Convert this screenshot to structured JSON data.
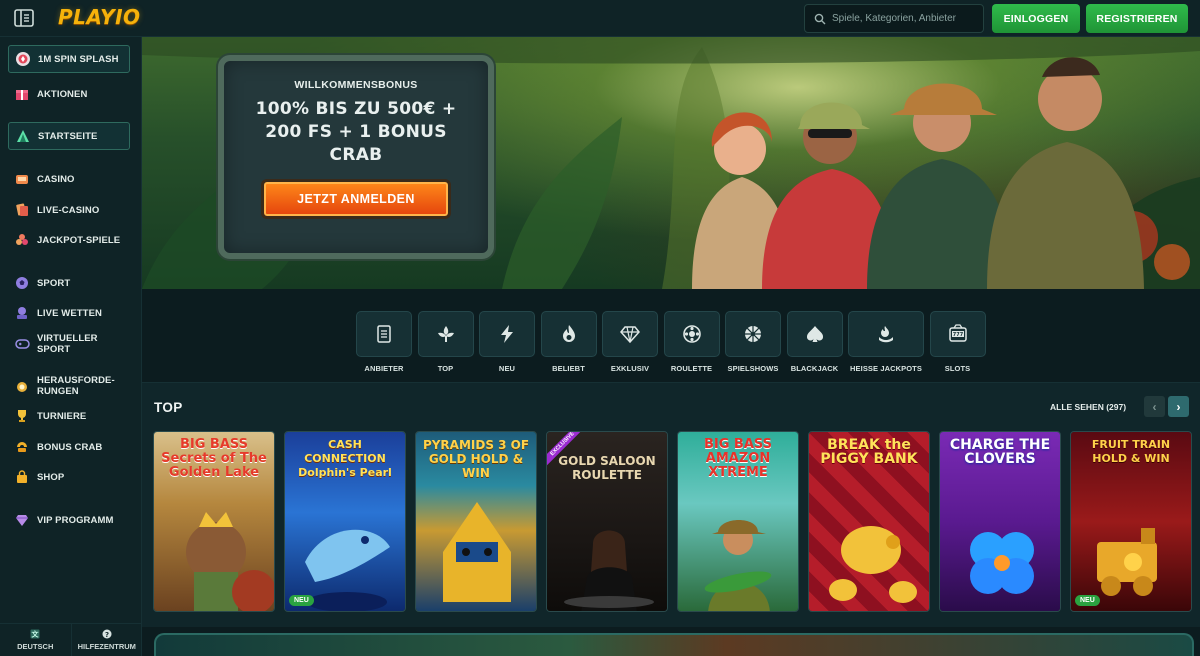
{
  "header": {
    "logo": "PLAYIO",
    "search_placeholder": "Spiele, Kategorien, Anbieter",
    "login_label": "EINLOGGEN",
    "register_label": "REGISTRIEREN"
  },
  "sidebar": {
    "items": [
      {
        "label": "1M SPIN SPLASH",
        "icon": "splash-icon"
      },
      {
        "label": "AKTIONEN",
        "icon": "gift-icon"
      },
      {
        "label": "STARTSEITE",
        "icon": "home-icon"
      },
      {
        "label": "CASINO",
        "icon": "casino-icon"
      },
      {
        "label": "LIVE-CASINO",
        "icon": "live-casino-icon"
      },
      {
        "label": "JACKPOT-SPIELE",
        "icon": "jackpot-icon"
      },
      {
        "label": "SPORT",
        "icon": "soccer-ball-icon"
      },
      {
        "label": "LIVE WETTEN",
        "icon": "live-bet-icon"
      },
      {
        "label": "VIRTUELLER SPORT",
        "icon": "gamepad-icon"
      },
      {
        "label": "HERAUSFORDE-RUNGEN",
        "icon": "medal-icon"
      },
      {
        "label": "TURNIERE",
        "icon": "trophy-icon"
      },
      {
        "label": "BONUS CRAB",
        "icon": "claw-icon"
      },
      {
        "label": "SHOP",
        "icon": "shopping-bag-icon"
      },
      {
        "label": "VIP PROGRAMM",
        "icon": "diamond-icon"
      }
    ],
    "footer": {
      "language": "DEUTSCH",
      "help": "HILFEZENTRUM"
    }
  },
  "hero": {
    "kicker": "WILLKOMMENSBONUS",
    "title": "100% BIS ZU 500€ + 200 FS + 1 BONUS CRAB",
    "cta": "JETZT ANMELDEN"
  },
  "categories": [
    {
      "label": "ANBIETER",
      "icon": "provider-icon"
    },
    {
      "label": "TOP",
      "icon": "fleur-icon"
    },
    {
      "label": "NEU",
      "icon": "lightning-icon"
    },
    {
      "label": "BELIEBT",
      "icon": "flame-icon"
    },
    {
      "label": "EXKLUSIV",
      "icon": "gem-icon"
    },
    {
      "label": "ROULETTE",
      "icon": "roulette-icon"
    },
    {
      "label": "SPIELSHOWS",
      "icon": "wheel-icon"
    },
    {
      "label": "BLACKJACK",
      "icon": "spade-icon"
    },
    {
      "label": "HEISSE JACKPOTS",
      "icon": "hot-jackpot-icon"
    },
    {
      "label": "SLOTS",
      "icon": "slot-machine-icon"
    }
  ],
  "top_section": {
    "title": "TOP",
    "see_all": "ALLE SEHEN (297)",
    "games": [
      {
        "title": "BIG BASS Secrets of The Golden Lake",
        "badge": ""
      },
      {
        "title": "CASH CONNECTION Dolphin's Pearl",
        "badge": "NEU"
      },
      {
        "title": "PYRAMIDS 3 OF GOLD HOLD & WIN",
        "badge": ""
      },
      {
        "title": "GOLD SALOON ROULETTE",
        "badge": "EXCLUSIVE"
      },
      {
        "title": "BIG BASS AMAZON XTREME",
        "badge": ""
      },
      {
        "title": "BREAK the PIGGY BANK",
        "badge": ""
      },
      {
        "title": "CHARGE THE CLOVERS",
        "badge": ""
      },
      {
        "title": "FRUIT TRAIN HOLD & WIN",
        "badge": "NEU"
      }
    ]
  },
  "colors": {
    "accent_green": "#2fbb4b",
    "cta_orange": "#ff8a1a",
    "background": "#0c1c1f",
    "logo_gold": "#f5b20b"
  }
}
